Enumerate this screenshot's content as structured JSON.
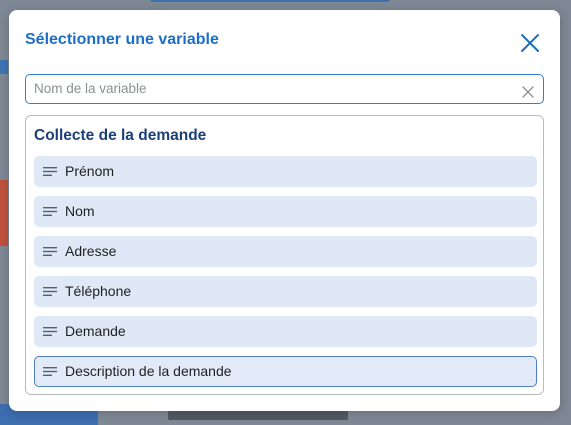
{
  "dialog": {
    "title": "Sélectionner une variable"
  },
  "search": {
    "placeholder": "Nom de la variable",
    "value": ""
  },
  "group": {
    "title": "Collecte de la demande",
    "items": [
      {
        "label": "Prénom",
        "selected": false
      },
      {
        "label": "Nom",
        "selected": false
      },
      {
        "label": "Adresse",
        "selected": false
      },
      {
        "label": "Téléphone",
        "selected": false
      },
      {
        "label": "Demande",
        "selected": false
      },
      {
        "label": "Description de la demande",
        "selected": true
      }
    ]
  },
  "colors": {
    "accent": "#1e6fc4",
    "group_title": "#1d3f78",
    "item_background": "#dfe8f7",
    "item_selected_border": "#4d7fc3"
  },
  "icons": {
    "close": "close-icon",
    "clear": "clear-icon",
    "variable": "text-lines-icon"
  }
}
